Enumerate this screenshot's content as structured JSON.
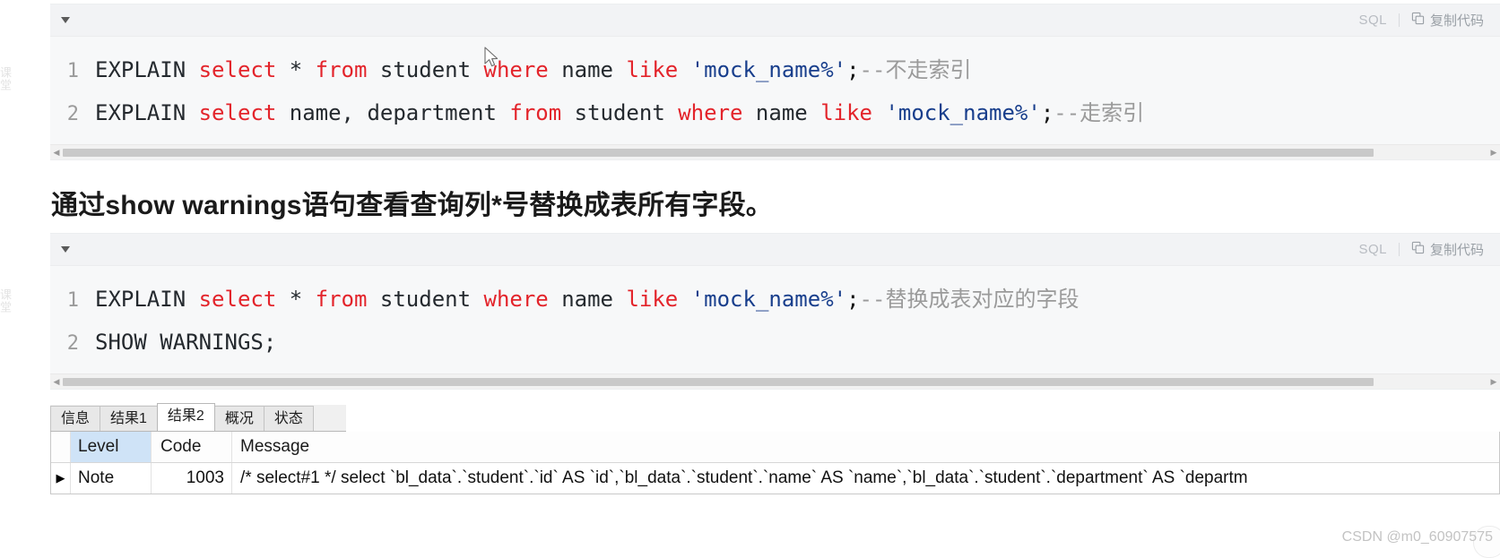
{
  "watermarks": {
    "left_edge": "课堂",
    "csdn": "CSDN @m0_60907575"
  },
  "code_block_1": {
    "toolbar": {
      "collapse_label": "",
      "language": "SQL",
      "copy_label": "复制代码",
      "copy_icon": "copy-icon"
    },
    "lines": [
      {
        "number": "1",
        "tokens": [
          {
            "text": "EXPLAIN ",
            "type": "plain"
          },
          {
            "text": "select",
            "type": "keyword"
          },
          {
            "text": " * ",
            "type": "plain"
          },
          {
            "text": "from",
            "type": "keyword"
          },
          {
            "text": " student ",
            "type": "plain"
          },
          {
            "text": "where",
            "type": "keyword"
          },
          {
            "text": " name ",
            "type": "plain"
          },
          {
            "text": "like",
            "type": "keyword"
          },
          {
            "text": " ",
            "type": "plain"
          },
          {
            "text": "'mock_name%'",
            "type": "string"
          },
          {
            "text": ";",
            "type": "punct"
          },
          {
            "text": "--不走索引",
            "type": "comment"
          }
        ]
      },
      {
        "number": "2",
        "tokens": [
          {
            "text": "EXPLAIN ",
            "type": "plain"
          },
          {
            "text": "select",
            "type": "keyword"
          },
          {
            "text": " name, department ",
            "type": "plain"
          },
          {
            "text": "from",
            "type": "keyword"
          },
          {
            "text": " student ",
            "type": "plain"
          },
          {
            "text": "where",
            "type": "keyword"
          },
          {
            "text": " name ",
            "type": "plain"
          },
          {
            "text": "like",
            "type": "keyword"
          },
          {
            "text": " ",
            "type": "plain"
          },
          {
            "text": "'mock_name%'",
            "type": "string"
          },
          {
            "text": ";",
            "type": "punct"
          },
          {
            "text": "--走索引",
            "type": "comment"
          }
        ]
      }
    ]
  },
  "paragraph": {
    "text": "通过show warnings语句查看查询列*号替换成表所有字段。"
  },
  "code_block_2": {
    "toolbar": {
      "collapse_label": "",
      "language": "SQL",
      "copy_label": "复制代码",
      "copy_icon": "copy-icon"
    },
    "lines": [
      {
        "number": "1",
        "tokens": [
          {
            "text": "EXPLAIN ",
            "type": "plain"
          },
          {
            "text": "select",
            "type": "keyword"
          },
          {
            "text": " * ",
            "type": "plain"
          },
          {
            "text": "from",
            "type": "keyword"
          },
          {
            "text": " student ",
            "type": "plain"
          },
          {
            "text": "where",
            "type": "keyword"
          },
          {
            "text": " name ",
            "type": "plain"
          },
          {
            "text": "like",
            "type": "keyword"
          },
          {
            "text": " ",
            "type": "plain"
          },
          {
            "text": "'mock_name%'",
            "type": "string"
          },
          {
            "text": ";",
            "type": "punct"
          },
          {
            "text": "--替换成表对应的字段",
            "type": "comment"
          }
        ]
      },
      {
        "number": "2",
        "tokens": [
          {
            "text": "SHOW WARNINGS;",
            "type": "plain"
          }
        ]
      }
    ]
  },
  "result_pane": {
    "tabs": [
      {
        "label": "信息",
        "active": false
      },
      {
        "label": "结果1",
        "active": false
      },
      {
        "label": "结果2",
        "active": true
      },
      {
        "label": "概况",
        "active": false
      },
      {
        "label": "状态",
        "active": false
      }
    ],
    "grid": {
      "columns": [
        "Level",
        "Code",
        "Message"
      ],
      "row_marker": "▶",
      "rows": [
        {
          "level": "Note",
          "code": "1003",
          "message": "/* select#1 */ select `bl_data`.`student`.`id` AS `id`,`bl_data`.`student`.`name` AS `name`,`bl_data`.`student`.`department` AS `departm"
        }
      ]
    }
  },
  "colors": {
    "keyword": "#e3242b",
    "string": "#183e8c",
    "comment": "#9a9a9a",
    "header_highlight": "#cfe3f7"
  }
}
